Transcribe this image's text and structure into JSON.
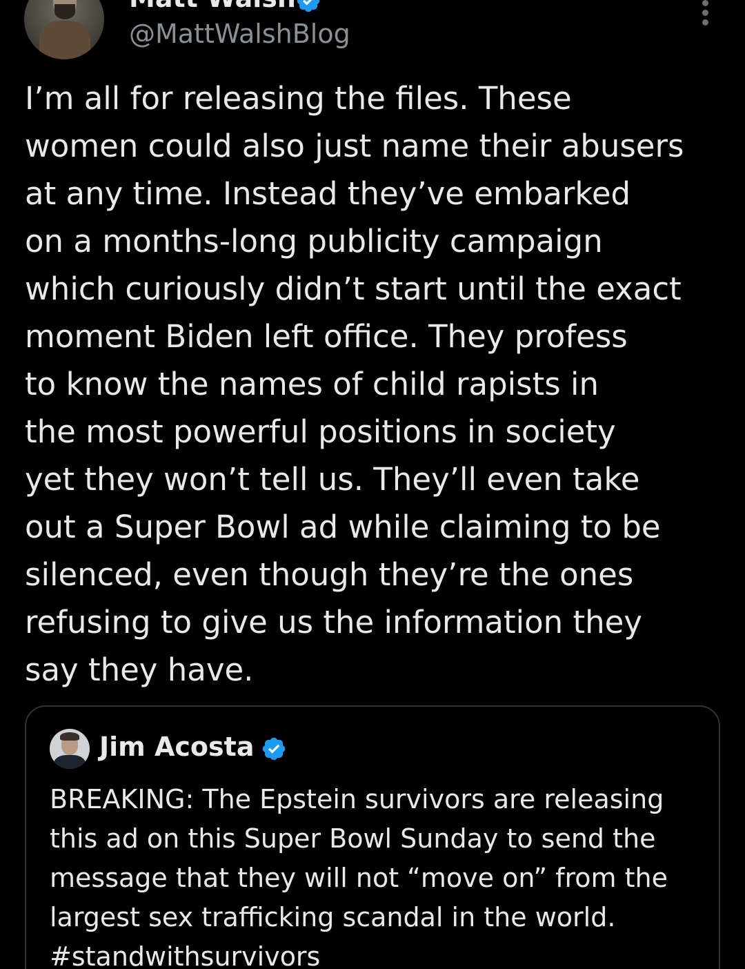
{
  "author": {
    "display_name": "Matt Walsh",
    "handle": "@MattWalshBlog",
    "verified": true
  },
  "tweet": {
    "text_lines": [
      "I’m all for releasing the files. These",
      "women could also just name their abusers",
      "at any time. Instead they’ve embarked",
      "on a months-long publicity campaign",
      "which curiously didn’t start until the exact",
      "moment Biden left office. They profess",
      "to know the names of child rapists in",
      "the most powerful positions in society",
      "yet they won’t tell us. They’ll even take",
      "out a Super Bowl ad while claiming to be",
      "silenced, even though they’re the ones",
      "refusing to give us the information they",
      "say they have."
    ]
  },
  "quoted_tweet": {
    "display_name": "Jim Acosta",
    "verified": true,
    "text_lines": [
      "BREAKING: The Epstein survivors are releasing",
      "this ad on this Super Bowl Sunday to send the",
      "message that they will not “move on” from the",
      "largest sex trafficking scandal in the world.",
      "#standwithsurvivors"
    ]
  },
  "colors": {
    "background": "#000000",
    "text": "#e7e9ea",
    "secondary_text": "#8b9096",
    "verified_badge": "#1d9bf0",
    "card_border": "#2f3336"
  },
  "icons": {
    "verified": "verified-badge-icon",
    "more": "more-options-icon"
  }
}
